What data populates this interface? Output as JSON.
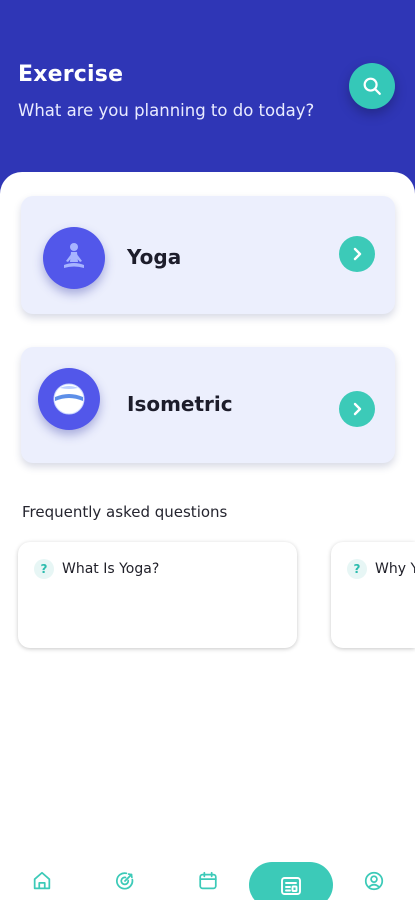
{
  "header": {
    "title": "Exercise",
    "subtitle": "What are you planning to do today?",
    "search_icon": "search-icon",
    "bg_color": "#2f36b6",
    "accent_color": "#35c8b8"
  },
  "categories": [
    {
      "label": "Yoga",
      "icon": "yoga-pose-icon"
    },
    {
      "label": "Isometric",
      "icon": "ball-icon"
    }
  ],
  "faq": {
    "title": "Frequently asked questions",
    "items": [
      {
        "question": "What Is Yoga?"
      },
      {
        "question": "Why Y"
      }
    ]
  },
  "bottom_nav": {
    "items": [
      {
        "icon": "home-icon",
        "active": false
      },
      {
        "icon": "target-icon",
        "active": false
      },
      {
        "icon": "calendar-icon",
        "active": false
      },
      {
        "icon": "exercise-list-icon",
        "active": true
      },
      {
        "icon": "profile-icon",
        "active": false
      }
    ]
  }
}
